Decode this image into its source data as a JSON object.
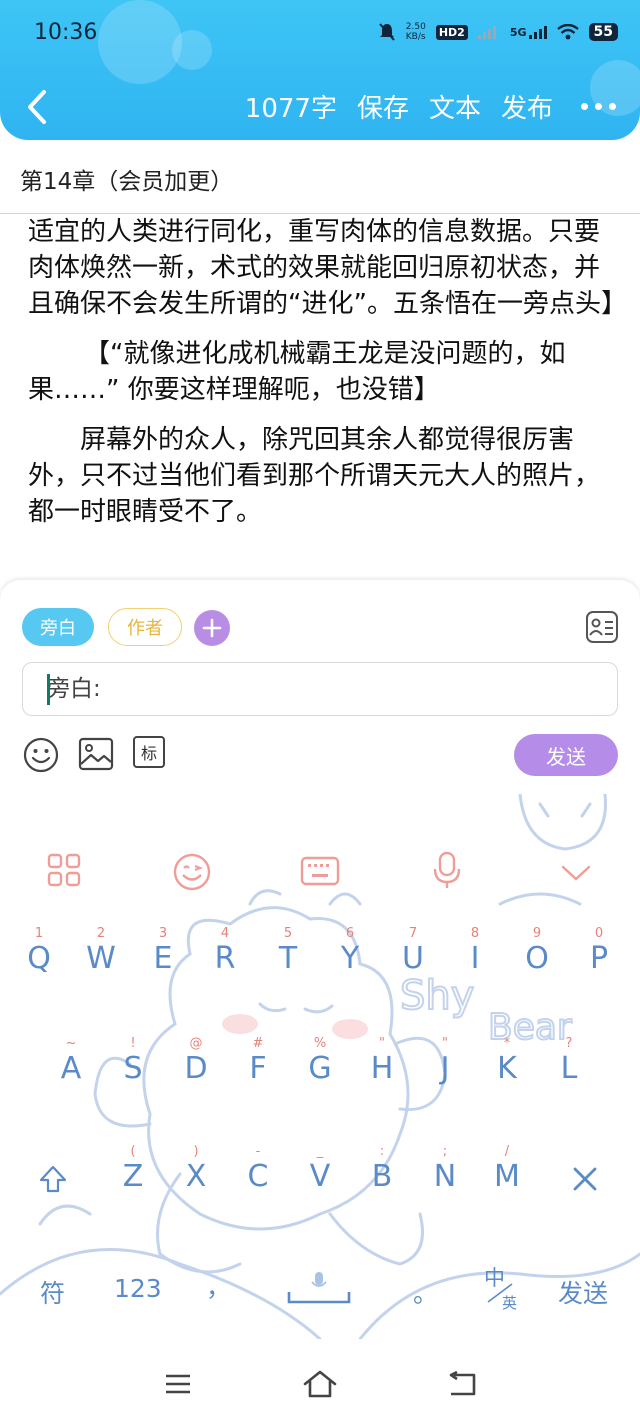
{
  "status_bar": {
    "time": "10:36",
    "net_speed_top": "2.50",
    "net_speed_bottom": "KB/s",
    "hd": "HD2",
    "network": "5G",
    "battery": "55"
  },
  "header": {
    "word_count": "1077字",
    "save_label": "保存",
    "text_label": "文本",
    "publish_label": "发布"
  },
  "chapter_title": "第14章（会员加更）",
  "content": {
    "paragraphs": [
      "适宜的人类进行同化，重写肉体的信息数据。只要肉体焕然一新，术式的效果就能回归原初状态，并且确保不会发生所谓的“进化”。五条悟在一旁点头】",
      "【“就像进化成机械霸王龙是没问题的，如果……” 你要这样理解呃，也没错】",
      "屏幕外的众人，除咒回其余人都觉得很厉害外，只不过当他们看到那个所谓天元大人的照片，都一时眼睛受不了。"
    ]
  },
  "editor": {
    "role_narrator": "旁白",
    "role_author": "作者",
    "input_value": "旁白:",
    "mark_label": "标",
    "send_label": "发送"
  },
  "keyboard": {
    "row1": [
      {
        "hint": "1",
        "key": "Q"
      },
      {
        "hint": "2",
        "key": "W"
      },
      {
        "hint": "3",
        "key": "E"
      },
      {
        "hint": "4",
        "key": "R"
      },
      {
        "hint": "5",
        "key": "T"
      },
      {
        "hint": "6",
        "key": "Y"
      },
      {
        "hint": "7",
        "key": "U"
      },
      {
        "hint": "8",
        "key": "I"
      },
      {
        "hint": "9",
        "key": "O"
      },
      {
        "hint": "0",
        "key": "P"
      }
    ],
    "row2": [
      {
        "hint": "~",
        "key": "A"
      },
      {
        "hint": "!",
        "key": "S"
      },
      {
        "hint": "@",
        "key": "D"
      },
      {
        "hint": "#",
        "key": "F"
      },
      {
        "hint": "%",
        "key": "G"
      },
      {
        "hint": "\"",
        "key": "H"
      },
      {
        "hint": "\"",
        "key": "J"
      },
      {
        "hint": "*",
        "key": "K"
      },
      {
        "hint": "?",
        "key": "L"
      }
    ],
    "row3": [
      {
        "hint": "(",
        "key": "Z"
      },
      {
        "hint": ")",
        "key": "X"
      },
      {
        "hint": "-",
        "key": "C"
      },
      {
        "hint": "_",
        "key": "V"
      },
      {
        "hint": ":",
        "key": "B"
      },
      {
        "hint": ";",
        "key": "N"
      },
      {
        "hint": "/",
        "key": "M"
      }
    ],
    "symbols_label": "符",
    "numbers_label": "123",
    "comma_label": "，",
    "period_label": "。",
    "lang_zh": "中",
    "lang_en": "英",
    "send_label": "发送",
    "bg_text_1": "Shy",
    "bg_text_2": "Bear"
  },
  "colors": {
    "header_blue": "#2fb4f1",
    "narrator_chip": "#57c8f1",
    "author_chip_text": "#e7b53c",
    "send_purple": "#b58ce8",
    "key_text": "#5a8ac8",
    "key_hint": "#e7827a"
  }
}
